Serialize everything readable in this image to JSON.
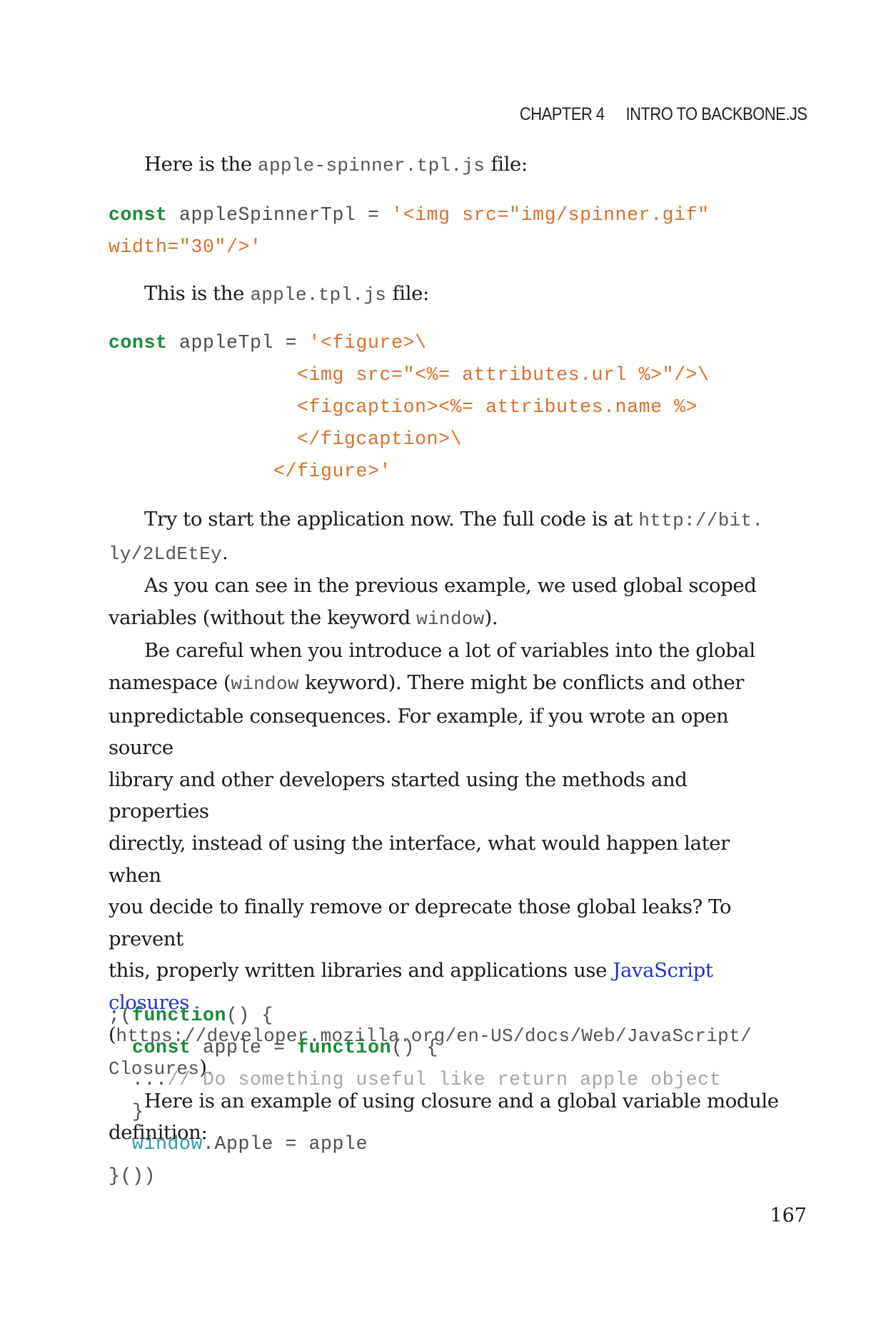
{
  "header": {
    "chapter": "CHAPTER 4",
    "title": "INTRO TO BACKBONE.JS"
  },
  "para1": {
    "before": "Here is the ",
    "code": "apple-spinner.tpl.js",
    "after": " file:"
  },
  "code1": {
    "kw": "const",
    "decl": " appleSpinnerTpl = ",
    "str1": "'<img src=\"img/spinner.gif\"",
    "str2": "width=\"30\"/>'"
  },
  "para2": {
    "before": "This is the ",
    "code": "apple.tpl.js",
    "after": " file:"
  },
  "code2": {
    "kw": "const",
    "decl": " appleTpl = ",
    "l1": "'<figure>\\",
    "l2": "                <img src=\"<%= attributes.url %>\"/>\\",
    "l3": "                <figcaption><%= attributes.name %>",
    "l4": "                </figcaption>\\",
    "l5": "              </figure>'"
  },
  "para3": {
    "text": "Try to start the application now. The full code is at ",
    "url1": "http://bit.",
    "url2": "ly/2LdEtEy",
    "after": "."
  },
  "para4": {
    "text1": "As you can see in the previous example, we used global scoped",
    "text2": "variables (without the keyword ",
    "code": "window",
    "after": ")."
  },
  "para5": {
    "l1": "Be careful when you introduce a lot of variables into the global",
    "l2a": "namespace (",
    "l2code": "window",
    "l2b": " keyword). There might be conflicts and other",
    "l3": "unpredictable consequences. For example, if you wrote an open source",
    "l4": "library and other developers started using the methods and properties",
    "l5": "directly, instead of using the interface, what would happen later when",
    "l6": "you decide to finally remove or deprecate those global leaks? To prevent",
    "l7a": "this, properly written libraries and applications use ",
    "l7link": "JavaScript closures",
    "l8a": "(",
    "l8url": "https://developer.mozilla.org/en-US/docs/Web/JavaScript/",
    "l9url": "Closures",
    "l9b": ")."
  },
  "para6": {
    "l1": "Here is an example of using closure and a global variable module",
    "l2": "definition:"
  },
  "code3": {
    "l1a": ";(",
    "l1kw": "function",
    "l1b": "() {",
    "l2pad": "  ",
    "l2kw": "const",
    "l2a": " apple = ",
    "l2kw2": "function",
    "l2b": "() {",
    "l3pad": "  ...",
    "l3cmt": "// Do something useful like return apple object",
    "l4": "  }",
    "l5pad": "  ",
    "l5glob": "window",
    "l5b": ".Apple = apple",
    "l6": "}())"
  },
  "page_number": "167"
}
